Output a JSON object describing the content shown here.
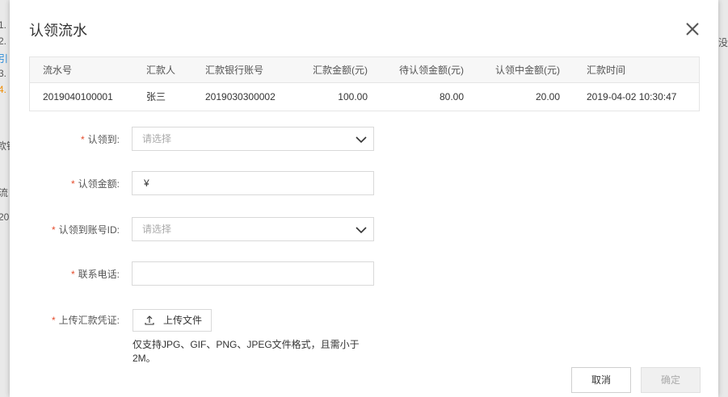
{
  "modal": {
    "title": "认领流水"
  },
  "table": {
    "headers": [
      "流水号",
      "汇款人",
      "汇款银行账号",
      "汇款金额(元)",
      "待认领金额(元)",
      "认领中金额(元)",
      "汇款时间"
    ],
    "rows": [
      [
        "2019040100001",
        "张三",
        "2019030300002",
        "100.00",
        "80.00",
        "20.00",
        "2019-04-02 10:30:47"
      ]
    ]
  },
  "form": {
    "required_mark": "*",
    "claim_to": {
      "label": "认领到:",
      "placeholder": "请选择"
    },
    "claim_amount": {
      "label": "认领金额:",
      "prefix": "¥",
      "value": ""
    },
    "claim_account": {
      "label": "认领到账号ID:",
      "placeholder": "请选择"
    },
    "phone": {
      "label": "联系电话:",
      "value": ""
    },
    "voucher": {
      "label": "上传汇款凭证:",
      "button": "上传文件",
      "hint": "仅支持JPG、GIF、PNG、JPEG文件格式，且需小于2M。"
    }
  },
  "footer": {
    "cancel": "取消",
    "confirm": "确定"
  },
  "background": {
    "left_fragments": [
      "1. ",
      "2. ",
      "引",
      "3.",
      "4.",
      "款银",
      "流",
      "20"
    ],
    "right_fragment": "没"
  }
}
